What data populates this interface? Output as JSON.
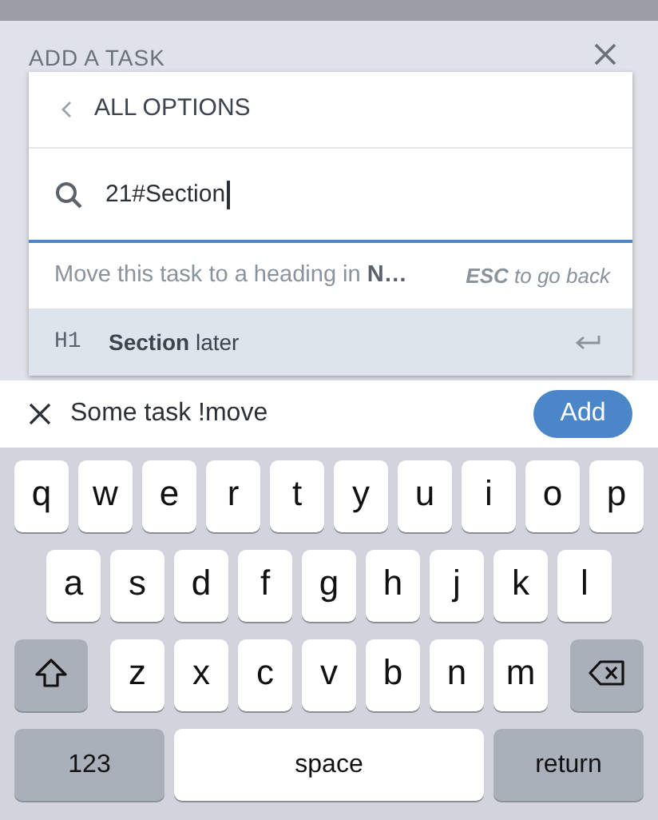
{
  "sheet": {
    "title": "ADD A TASK"
  },
  "popup": {
    "back_label": "ALL OPTIONS",
    "search": {
      "value": "21#Section"
    },
    "hint": "Move this task to a heading in **N…**",
    "hint_right": "**ESC** to go back",
    "options": [
      {
        "tag": "H1",
        "label": "**Section** later",
        "selected": true
      }
    ]
  },
  "task_input": {
    "value": "Some task !move"
  },
  "add_button": "Add",
  "keyboard": [
    [
      {
        "kind": "letter",
        "label": "q"
      },
      {
        "kind": "letter",
        "label": "w"
      },
      {
        "kind": "letter",
        "label": "e"
      },
      {
        "kind": "letter",
        "label": "r"
      },
      {
        "kind": "letter",
        "label": "t"
      },
      {
        "kind": "letter",
        "label": "y"
      },
      {
        "kind": "letter",
        "label": "u"
      },
      {
        "kind": "letter",
        "label": "i"
      },
      {
        "kind": "letter",
        "label": "o"
      },
      {
        "kind": "letter",
        "label": "p"
      }
    ],
    [
      {
        "kind": "letter",
        "label": "a"
      },
      {
        "kind": "letter",
        "label": "s"
      },
      {
        "kind": "letter",
        "label": "d"
      },
      {
        "kind": "letter",
        "label": "f"
      },
      {
        "kind": "letter",
        "label": "g"
      },
      {
        "kind": "letter",
        "label": "h"
      },
      {
        "kind": "letter",
        "label": "j"
      },
      {
        "kind": "letter",
        "label": "k"
      },
      {
        "kind": "letter",
        "label": "l"
      }
    ],
    [
      {
        "kind": "shift"
      },
      {
        "kind": "letter",
        "label": "z"
      },
      {
        "kind": "letter",
        "label": "x"
      },
      {
        "kind": "letter",
        "label": "c"
      },
      {
        "kind": "letter",
        "label": "v"
      },
      {
        "kind": "letter",
        "label": "b"
      },
      {
        "kind": "letter",
        "label": "n"
      },
      {
        "kind": "letter",
        "label": "m"
      },
      {
        "kind": "backspace"
      }
    ],
    [
      {
        "kind": "numbers",
        "label": "123"
      },
      {
        "kind": "space",
        "label": "space"
      },
      {
        "kind": "return",
        "label": "return"
      }
    ]
  ]
}
